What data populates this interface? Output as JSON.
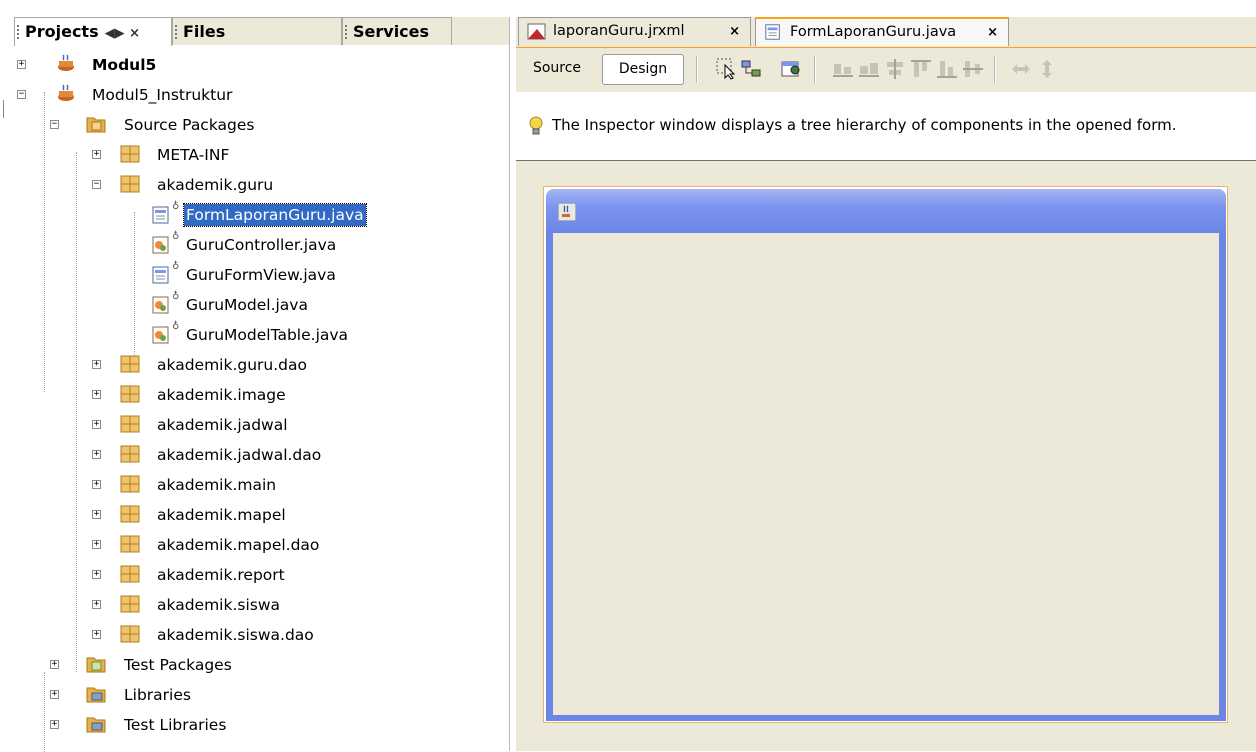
{
  "left_panel": {
    "tabs": [
      {
        "label": "Projects",
        "controls": "◀▶ ×",
        "active": true
      },
      {
        "label": "Files"
      },
      {
        "label": "Services"
      }
    ],
    "tree": [
      {
        "label": "Modul5",
        "bold": true
      },
      {
        "label": "Modul5_Instruktur"
      },
      {
        "label": "Source Packages"
      },
      {
        "label": "META-INF"
      },
      {
        "label": "akademik.guru"
      },
      {
        "label": "FormLaporanGuru.java",
        "selected": true
      },
      {
        "label": "GuruController.java"
      },
      {
        "label": "GuruFormView.java"
      },
      {
        "label": "GuruModel.java"
      },
      {
        "label": "GuruModelTable.java"
      },
      {
        "label": "akademik.guru.dao"
      },
      {
        "label": "akademik.image"
      },
      {
        "label": "akademik.jadwal"
      },
      {
        "label": "akademik.jadwal.dao"
      },
      {
        "label": "akademik.main"
      },
      {
        "label": "akademik.mapel"
      },
      {
        "label": "akademik.mapel.dao"
      },
      {
        "label": "akademik.report"
      },
      {
        "label": "akademik.siswa"
      },
      {
        "label": "akademik.siswa.dao"
      },
      {
        "label": "Test Packages"
      },
      {
        "label": "Libraries"
      },
      {
        "label": "Test Libraries"
      }
    ]
  },
  "editor": {
    "tabs": [
      {
        "label": "laporanGuru.jrxml",
        "close": "×"
      },
      {
        "label": "FormLaporanGuru.java",
        "close": "×",
        "active": true
      }
    ],
    "toolbar": {
      "source_label": "Source",
      "design_label": "Design"
    },
    "info_text": "The Inspector window displays a tree hierarchy of components in the opened form."
  },
  "colors": {
    "selection": "#316ac5",
    "tab_accent": "#ffa21a",
    "frame_title": "#7c95ee",
    "panel_bg": "#ece9d8"
  }
}
